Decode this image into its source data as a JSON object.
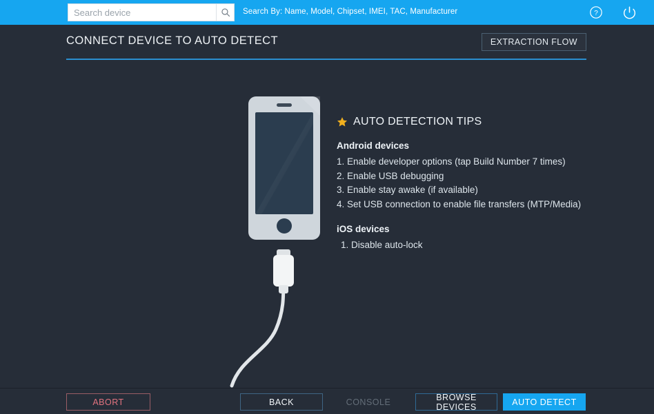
{
  "topbar": {
    "accent_color": "#16a6f0",
    "search": {
      "placeholder": "Search device",
      "value": "",
      "button_icon": "search-icon"
    },
    "hint": "Search By: Name, Model, Chipset, IMEI, TAC, Manufacturer",
    "help_icon": "help-circle-icon",
    "power_icon": "power-icon"
  },
  "header": {
    "title": "CONNECT DEVICE TO AUTO DETECT",
    "extraction_flow_label": "EXTRACTION FLOW",
    "rule_color": "#2a8fd0"
  },
  "illustration": {
    "phone_icon": "smartphone-illustration",
    "cable_icon": "usb-cable-illustration",
    "phone_body_color": "#cfd6dc",
    "phone_screen_color": "#2b3d4f",
    "cable_color": "#e4e7ea"
  },
  "tips": {
    "star_icon": "star-icon",
    "star_color": "#f2b01e",
    "heading": "AUTO DETECTION TIPS",
    "sections": [
      {
        "title": "Android devices",
        "items": [
          "1. Enable developer options (tap Build Number 7 times)",
          "2. Enable USB debugging",
          "3. Enable stay awake (if available)",
          "4. Set USB connection to enable file transfers (MTP/Media)"
        ]
      },
      {
        "title": "iOS devices",
        "items": [
          "1. Disable auto-lock"
        ]
      }
    ]
  },
  "footer": {
    "buttons": [
      {
        "label": "ABORT",
        "state": "enabled",
        "style": "danger-outline"
      },
      {
        "label": "BACK",
        "state": "enabled",
        "style": "outline"
      },
      {
        "label": "CONSOLE",
        "state": "disabled",
        "style": "ghost"
      },
      {
        "label": "BROWSE DEVICES",
        "state": "enabled",
        "style": "outline"
      },
      {
        "label": "AUTO DETECT",
        "state": "enabled",
        "style": "primary"
      }
    ]
  },
  "background_color": "#262d38"
}
